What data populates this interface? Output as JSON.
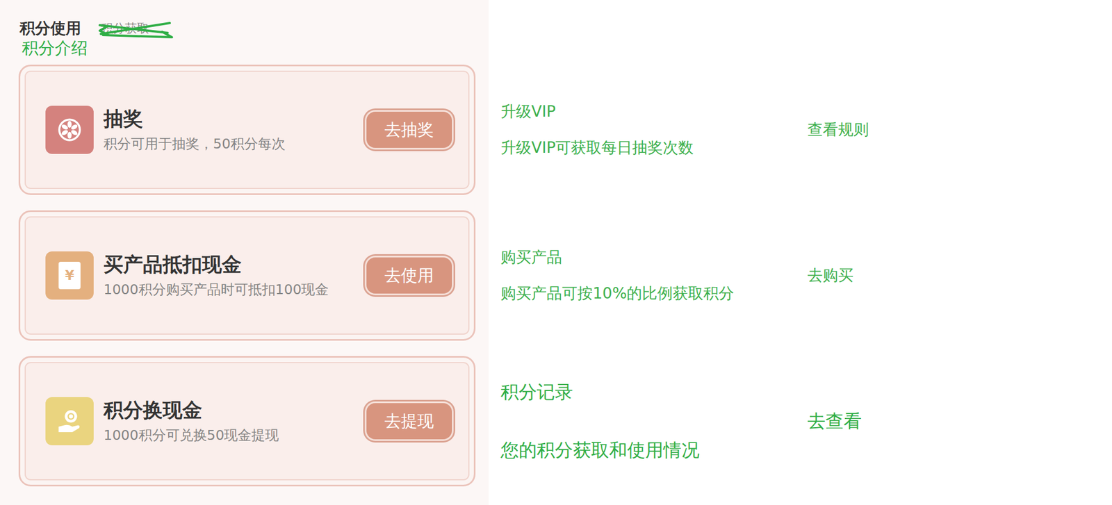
{
  "header": {
    "tabs": [
      {
        "label": "积分使用",
        "struck": false
      },
      {
        "label": "积分获取",
        "struck": true
      }
    ],
    "note": "积分介绍"
  },
  "cards": [
    {
      "kind": "lottery",
      "color": "#d4827e",
      "title": "抽奖",
      "desc": "积分可用于抽奖，50积分每次",
      "button": "去抽奖",
      "annotation": {
        "title": "升级VIP",
        "desc": "升级VIP可获取每日抽奖次数",
        "action": "查看规则"
      }
    },
    {
      "kind": "voucher",
      "color": "#e4b07f",
      "glyph": "¥",
      "title": "买产品抵扣现金",
      "desc": "1000积分购买产品时可抵扣100现金",
      "button": "去使用",
      "annotation": {
        "title": "购买产品",
        "desc": "购买产品可按10%的比例获取积分",
        "action": "去购买"
      }
    },
    {
      "kind": "cash",
      "color": "#ead47f",
      "title": "积分换现金",
      "desc": "1000积分可兑换50现金提现",
      "button": "去提现",
      "annotation": {
        "title": "积分记录",
        "desc": "您的积分获取和使用情况",
        "action": "去查看"
      }
    }
  ]
}
